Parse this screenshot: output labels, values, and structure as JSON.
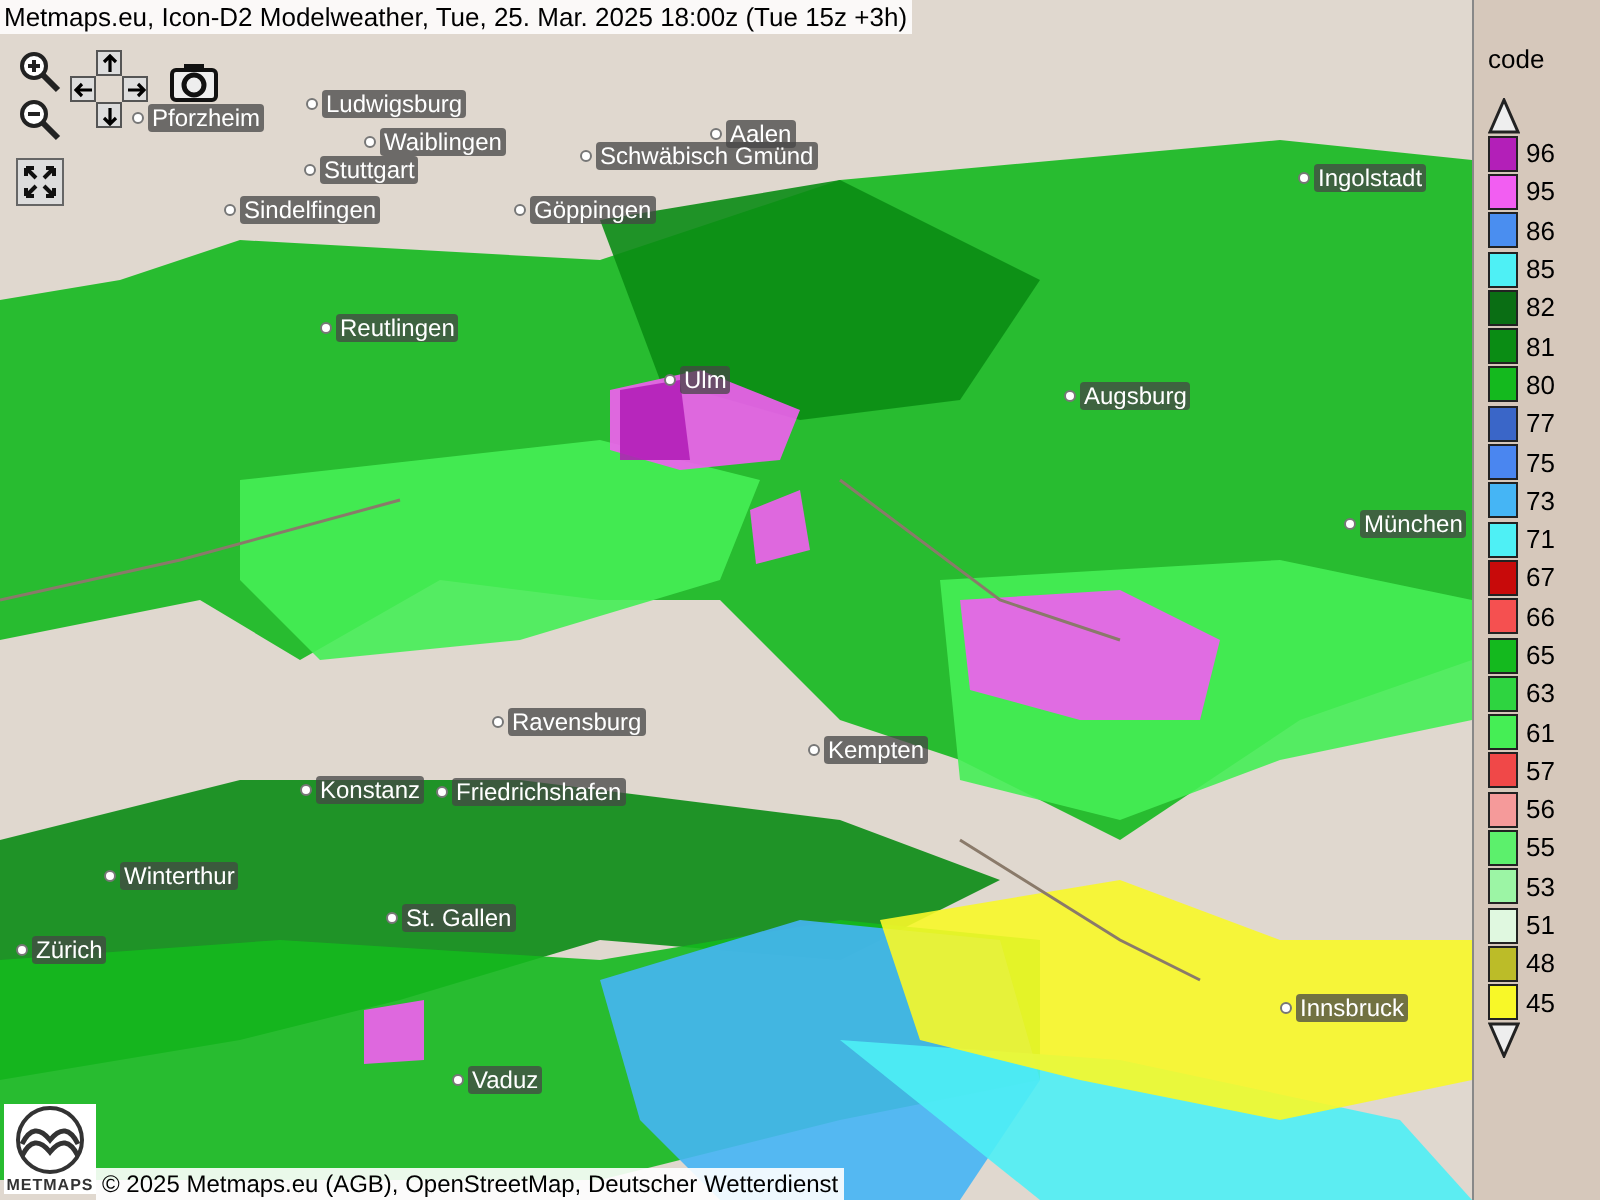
{
  "title": "Metmaps.eu, Icon-D2 Modelweather, Tue, 25. Mar. 2025 18:00z (Tue 15z +3h)",
  "cities": [
    "Ludwigsburg",
    "Pforzheim",
    "Waiblingen",
    "Stuttgart",
    "Aalen",
    "Schwäbisch Gmünd",
    "Sindelfingen",
    "Göppingen",
    "Ingolstadt",
    "Reutlingen",
    "Ulm",
    "Augsburg",
    "München",
    "Ravensburg",
    "Kempten",
    "Konstanz",
    "Friedrichshafen",
    "Winterthur",
    "St. Gallen",
    "Zürich",
    "Innsbruck",
    "Vaduz"
  ],
  "legend": {
    "title": "code",
    "items": [
      {
        "label": "96",
        "color": "#b31fb8"
      },
      {
        "label": "95",
        "color": "#f25ef2"
      },
      {
        "label": "86",
        "color": "#4a8ef0"
      },
      {
        "label": "85",
        "color": "#4ef0f5"
      },
      {
        "label": "82",
        "color": "#0a6e14"
      },
      {
        "label": "81",
        "color": "#0a8c14"
      },
      {
        "label": "80",
        "color": "#14b91e"
      },
      {
        "label": "77",
        "color": "#3a66c8"
      },
      {
        "label": "75",
        "color": "#4a86f0"
      },
      {
        "label": "73",
        "color": "#45b5f5"
      },
      {
        "label": "71",
        "color": "#4ef0f5"
      },
      {
        "label": "67",
        "color": "#c80a0a"
      },
      {
        "label": "66",
        "color": "#f55050"
      },
      {
        "label": "65",
        "color": "#14b91e"
      },
      {
        "label": "63",
        "color": "#2ed440"
      },
      {
        "label": "61",
        "color": "#45ee55"
      },
      {
        "label": "57",
        "color": "#f04848"
      },
      {
        "label": "56",
        "color": "#f59a9a"
      },
      {
        "label": "55",
        "color": "#5cf06c"
      },
      {
        "label": "53",
        "color": "#9cf5a5"
      },
      {
        "label": "51",
        "color": "#e0f8e0"
      },
      {
        "label": "48",
        "color": "#bcbc28"
      },
      {
        "label": "45",
        "color": "#f8f828"
      }
    ]
  },
  "logo_text": "METMAPS",
  "attribution": "© 2025 Metmaps.eu (AGB), OpenStreetMap, Deutscher Wetterdienst"
}
